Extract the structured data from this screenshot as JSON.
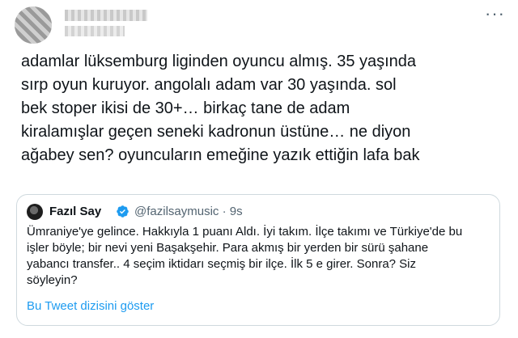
{
  "author": {
    "avatar_icon": "blurred-avatar",
    "name_redacted": true,
    "more_icon": "more-options-icon",
    "more_glyph": "···"
  },
  "tweet": {
    "text": "adamlar lüksemburg liginden oyuncu almış. 35 yaşında\nsırp oyun kuruyor. angolalı adam var 30 yaşında. sol\nbek stoper ikisi de 30+… birkaç tane de adam\nkiralamışlar geçen seneki kadronun üstüne… ne diyon\nağabey sen? oyuncuların emeğine yazık ettiğin lafa bak"
  },
  "quoted_tweet": {
    "name": "Fazıl Say",
    "verified_icon": "verified-badge-icon",
    "handle": "@fazilsaymusic",
    "separator": "·",
    "time": "9s",
    "text": "Ümraniye'ye gelince. Hakkıyla 1 puanı Aldı. İyi takım. İlçe takımı ve Türkiye'de bu\nişler böyle; bir nevi yeni Başakşehir. Para akmış bir yerden bir sürü şahane\nyabancı transfer.. 4 seçim iktidarı seçmiş bir ilçe. İlk 5 e girer. Sonra? Siz\nsöyleyin?",
    "thread_link": "Bu Tweet dizisini göster"
  },
  "colors": {
    "text": "#0f1419",
    "secondary": "#536471",
    "link": "#1d9bf0",
    "border": "#cfd9de"
  }
}
